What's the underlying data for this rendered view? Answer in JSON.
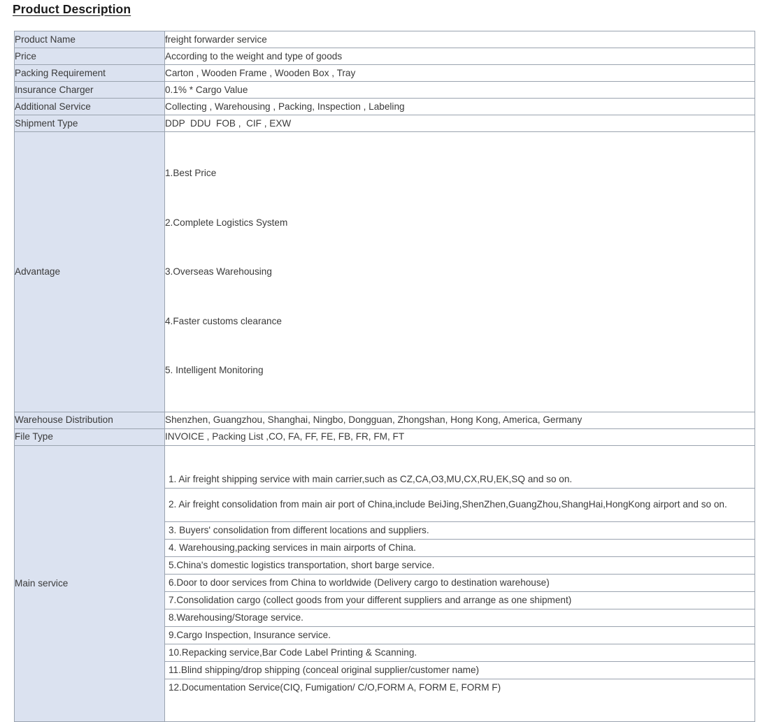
{
  "heading": "Product Description",
  "table": {
    "rows": [
      {
        "label": "Product Name",
        "value": "freight forwarder service"
      },
      {
        "label": "Price",
        "value": "According to the weight and type of goods"
      },
      {
        "label": "Packing Requirement",
        "value": "Carton , Wooden Frame , Wooden Box , Tray"
      },
      {
        "label": "Insurance Charger",
        "value": "0.1% * Cargo Value"
      },
      {
        "label": "Additional Service",
        "value": "Collecting , Warehousing , Packing, Inspection , Labeling"
      },
      {
        "label": "Shipment Type",
        "value": "DDP  DDU  FOB ,  CIF , EXW"
      }
    ],
    "advantage": {
      "label": "Advantage",
      "items": [
        "1.Best Price",
        "2.Complete Logistics System",
        "3.Overseas Warehousing",
        "4.Faster customs clearance",
        "5. Intelligent Monitoring"
      ]
    },
    "rows_after_advantage": [
      {
        "label": "Warehouse Distribution",
        "value": "Shenzhen, Guangzhou, Shanghai, Ningbo, Dongguan, Zhongshan, Hong Kong, America, Germany"
      },
      {
        "label": "File Type",
        "value": "INVOICE , Packing List ,CO, FA, FF, FE, FB, FR, FM, FT"
      }
    ],
    "main_service": {
      "label": "Main service",
      "items": [
        "1. Air freight shipping service with main carrier,such as CZ,CA,O3,MU,CX,RU,EK,SQ and so on.",
        "2. Air freight consolidation from main air port of China,include BeiJing,ShenZhen,GuangZhou,ShangHai,HongKong airport and so on.",
        "3. Buyers' consolidation from different locations and suppliers.",
        "4. Warehousing,packing services in main airports of China.",
        "5.China's domestic logistics transportation, short barge service.",
        "6.Door to door services from China to worldwide (Delivery cargo to destination warehouse)",
        "7.Consolidation cargo (collect goods from your different suppliers and arrange as one shipment)",
        "8.Warehousing/Storage service.",
        "9.Cargo Inspection, Insurance service.",
        "10.Repacking service,Bar Code Label Printing & Scanning.",
        "11.Blind shipping/drop shipping (conceal original supplier/customer name)",
        "12.Documentation Service(CIQ, Fumigation/ C/O,FORM A, FORM E, FORM F)"
      ]
    }
  },
  "colors": {
    "label_background": "#dbe2f0",
    "border": "#9aa3af",
    "text": "#3a3a3a",
    "heading_text": "#1a1a1a",
    "value_background": "#ffffff"
  }
}
